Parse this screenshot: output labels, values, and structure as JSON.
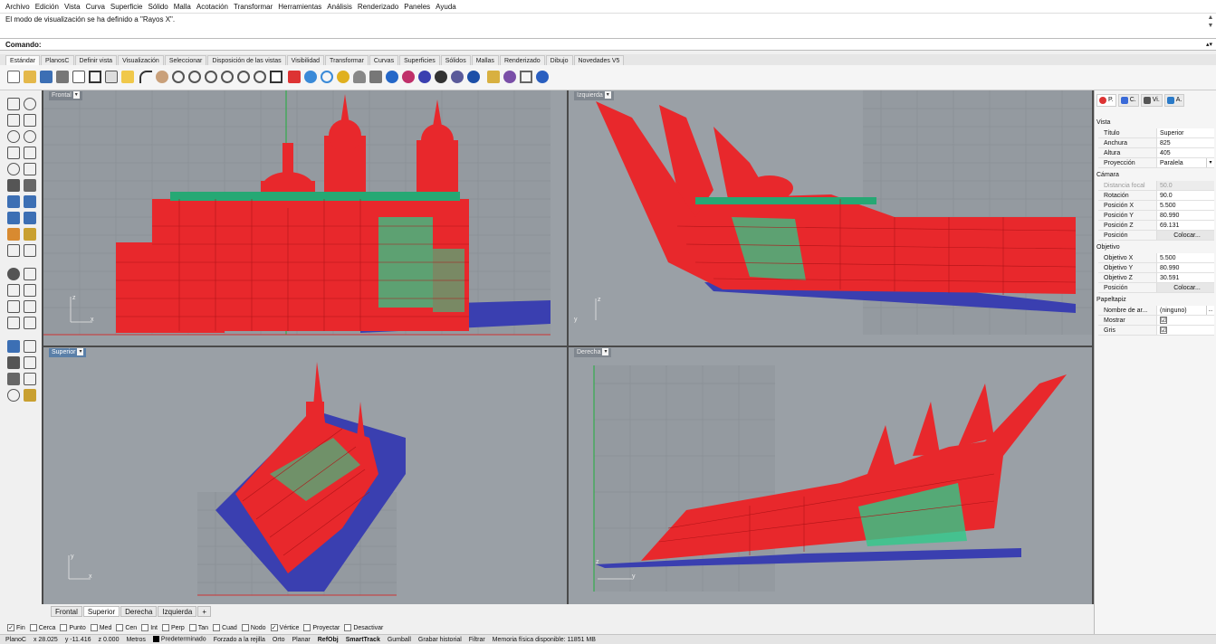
{
  "menu": [
    "Archivo",
    "Edición",
    "Vista",
    "Curva",
    "Superficie",
    "Sólido",
    "Malla",
    "Acotación",
    "Transformar",
    "Herramientas",
    "Análisis",
    "Renderizado",
    "Paneles",
    "Ayuda"
  ],
  "command_history": "El modo de visualización se ha definido a \"Rayos X\".",
  "command_label": "Comando:",
  "command_value": "",
  "toolbar_tabs": [
    "Estándar",
    "PlanosC",
    "Definir vista",
    "Visualización",
    "Seleccionar",
    "Disposición de las vistas",
    "Visibilidad",
    "Transformar",
    "Curvas",
    "Superficies",
    "Sólidos",
    "Mallas",
    "Renderizado",
    "Dibujo",
    "Novedades V5"
  ],
  "viewports": {
    "frontal": {
      "title": "Frontal"
    },
    "izquierda": {
      "title": "Izquierda"
    },
    "superior": {
      "title": "Superior"
    },
    "derecha": {
      "title": "Derecha"
    }
  },
  "axes": {
    "x": "x",
    "y": "y",
    "z": "z"
  },
  "viewport_tabs": [
    "Frontal",
    "Superior",
    "Derecha",
    "Izquierda"
  ],
  "viewport_tabs_add": "+",
  "osnaps": [
    {
      "label": "Fin",
      "checked": true
    },
    {
      "label": "Cerca",
      "checked": false
    },
    {
      "label": "Punto",
      "checked": false
    },
    {
      "label": "Med",
      "checked": false
    },
    {
      "label": "Cen",
      "checked": false
    },
    {
      "label": "Int",
      "checked": false
    },
    {
      "label": "Perp",
      "checked": false
    },
    {
      "label": "Tan",
      "checked": false
    },
    {
      "label": "Cuad",
      "checked": false
    },
    {
      "label": "Nodo",
      "checked": false
    },
    {
      "label": "Vértice",
      "checked": true
    },
    {
      "label": "Proyectar",
      "checked": false
    },
    {
      "label": "Desactivar",
      "checked": false
    }
  ],
  "status": {
    "cplane": "PlanoC",
    "x": "x 28.025",
    "y": "y -11.416",
    "z": "z 0.000",
    "units": "Metros",
    "layer": "Predeterminado",
    "toggles": [
      "Forzado a la rejilla",
      "Orto",
      "Planar",
      "RefObj",
      "SmartTrack",
      "Gumball",
      "Grabar historial",
      "Filtrar"
    ],
    "memory": "Memoria física disponible: 11851 MB"
  },
  "panel": {
    "tabs": [
      "P.",
      "C.",
      "Vi.",
      "A."
    ],
    "vista_header": "Vista",
    "titulo_label": "Título",
    "titulo": "Superior",
    "anchura_label": "Anchura",
    "anchura": "825",
    "altura_label": "Altura",
    "altura": "405",
    "proyeccion_label": "Proyección",
    "proyeccion": "Paralela",
    "camara_header": "Cámara",
    "distancia_label": "Distancia focal",
    "distancia": "50.0",
    "rotacion_label": "Rotación",
    "rotacion": "90.0",
    "camx_label": "Posición X",
    "camx": "5.500",
    "camy_label": "Posición Y",
    "camy": "80.990",
    "camz_label": "Posición Z",
    "camz": "69.131",
    "pos_label": "Posición",
    "colocar": "Colocar...",
    "objetivo_header": "Objetivo",
    "objx_label": "Objetivo X",
    "objx": "5.500",
    "objy_label": "Objetivo Y",
    "objy": "80.990",
    "objz_label": "Objetivo Z",
    "objz": "30.591",
    "objpos_label": "Posición",
    "objcolocar": "Colocar...",
    "papel_header": "Papeltapiz",
    "nombre_label": "Nombre de ar...",
    "nombre": "(ninguno)",
    "nombre_btn": "...",
    "mostrar_label": "Mostrar",
    "gris_label": "Gris",
    "check": "☑"
  },
  "colors": {
    "model_red": "#e8282c",
    "model_green": "#2fc98a",
    "model_blue": "#3a3fb0",
    "grid": "#8c9298",
    "viewport_bg": "#9aa0a6",
    "active_tab": "#5a7fa8"
  }
}
